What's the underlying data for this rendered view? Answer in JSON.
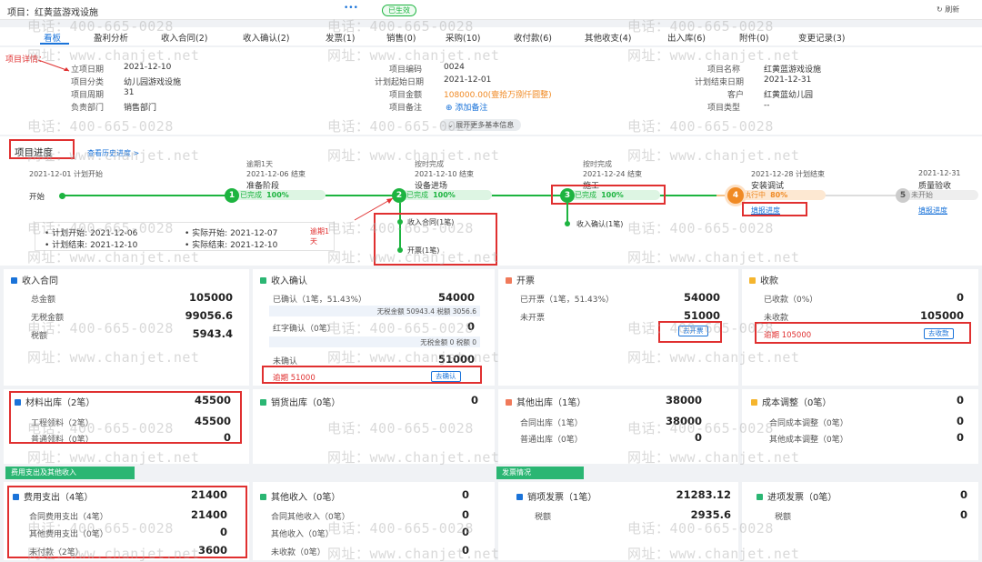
{
  "header": {
    "title": "项目：红黄蓝游戏设施",
    "more": "•••",
    "status": "已生效",
    "refresh": "刷新"
  },
  "tabs": [
    "看板",
    "盈利分析",
    "收入合同(2)",
    "收入确认(2)",
    "发票(1)",
    "销售(0)",
    "采购(10)",
    "收付款(6)",
    "其他收支(4)",
    "出入库(6)",
    "附件(0)",
    "变更记录(3)"
  ],
  "details": {
    "annotation": "项目详情：",
    "rows": [
      [
        {
          "label": "立项日期",
          "value": "2021-12-10"
        },
        {
          "label": "项目编码",
          "value": "0024"
        },
        {
          "label": "项目名称",
          "value": "红黄蓝游戏设施"
        }
      ],
      [
        {
          "label": "项目分类",
          "value": "幼儿园游戏设施"
        },
        {
          "label": "计划起始日期",
          "value": "2021-12-01"
        },
        {
          "label": "计划结束日期",
          "value": "2021-12-31"
        }
      ],
      [
        {
          "label": "项目周期",
          "value": "31"
        },
        {
          "label": "项目金额",
          "value": "108000.00(壹拾万捌仟圆整)"
        },
        {
          "label": "客户",
          "value": "红黄蓝幼儿园"
        }
      ],
      [
        {
          "label": "负责部门",
          "value": "销售部门"
        },
        {
          "label": "项目备注",
          "value": "添加备注"
        },
        {
          "label": "项目类型",
          "value": "--"
        }
      ]
    ],
    "expand": "展开更多基本信息"
  },
  "progress": {
    "title": "项目进度",
    "history_link": "查看历史进度 >",
    "start_line": "2021-12-01 计划开始",
    "start_label": "开始",
    "milestones": [
      {
        "num": "1",
        "top": "逾期1天",
        "date": "2021-12-06 结束",
        "name": "准备阶段",
        "state": "已完成",
        "pct": "100%",
        "kind": "done"
      },
      {
        "num": "2",
        "top": "按时完成",
        "date": "2021-12-10 结束",
        "name": "设备进场",
        "state": "已完成",
        "pct": "100%",
        "kind": "done"
      },
      {
        "num": "3",
        "top": "按时完成",
        "date": "2021-12-24 结束",
        "name": "施工",
        "state": "已完成",
        "pct": "100%",
        "kind": "done"
      },
      {
        "num": "4",
        "top": "",
        "date": "2021-12-28 计划结束",
        "name": "安装调试",
        "state": "执行中",
        "pct": "80%",
        "kind": "doing",
        "link": "填报进度"
      },
      {
        "num": "5",
        "top": "",
        "date": "2021-12-31",
        "name": "质量验收",
        "state": "未开始",
        "pct": "",
        "kind": "todo",
        "link": "填报进度"
      }
    ],
    "branch2": [
      "收入合同(1笔)",
      "开票(1笔)"
    ],
    "branch3": [
      "收入确认(1笔)"
    ],
    "plan_start": "• 计划开始: 2021-12-06",
    "plan_end": "• 计划结束: 2021-12-10",
    "act_start": "• 实际开始: 2021-12-07",
    "act_end": "• 实际结束: 2021-12-10",
    "overdue": "逾期1天"
  },
  "cards": {
    "contract": {
      "title": "收入合同",
      "rows": [
        {
          "label": "总金额",
          "value": "105000"
        },
        {
          "label": "无税金额",
          "value": "99056.6"
        },
        {
          "label": "税额",
          "value": "5943.4"
        }
      ]
    },
    "confirm": {
      "title": "收入确认",
      "confirmed_label": "已确认（1笔，51.43%）",
      "confirmed_value": "54000",
      "sub1": "无税金额 50943.4 税额 3056.6",
      "red_label": "红字确认（0笔）",
      "red_value": "0",
      "sub2": "无税金额 0 税额 0",
      "unconfirmed_label": "未确认",
      "unconfirmed_value": "51000",
      "overdue": "逾期 51000",
      "btn": "去确认"
    },
    "invoice": {
      "title": "开票",
      "rows": [
        {
          "label": "已开票（1笔，51.43%）",
          "value": "54000"
        },
        {
          "label": "未开票",
          "value": "51000"
        }
      ],
      "btn": "去开票"
    },
    "receipt": {
      "title": "收款",
      "rows": [
        {
          "label": "已收款（0%）",
          "value": "0"
        },
        {
          "label": "未收款",
          "value": "105000"
        }
      ],
      "overdue": "逾期 105000",
      "btn": "去收款"
    },
    "material": {
      "title": "材料出库（2笔）",
      "value": "45500",
      "rows": [
        {
          "label": "工程领料（2笔）",
          "value": "45500"
        },
        {
          "label": "普通领料（0笔）",
          "value": "0"
        }
      ]
    },
    "sales_out": {
      "title": "销货出库（0笔）",
      "value": "0"
    },
    "other_out": {
      "title": "其他出库（1笔）",
      "value": "38000",
      "rows": [
        {
          "label": "合同出库（1笔）",
          "value": "38000"
        },
        {
          "label": "普通出库（0笔）",
          "value": "0"
        }
      ]
    },
    "cost_adj": {
      "title": "成本调整（0笔）",
      "value": "0",
      "rows": [
        {
          "label": "合同成本调整（0笔）",
          "value": "0"
        },
        {
          "label": "其他成本调整（0笔）",
          "value": "0"
        }
      ]
    },
    "banner_left": "费用支出及其他收入",
    "banner_right": "发票情况",
    "expense": {
      "title": "费用支出（4笔）",
      "value": "21400",
      "rows": [
        {
          "label": "合同费用支出（4笔）",
          "value": "21400"
        },
        {
          "label": "其他费用支出（0笔）",
          "value": "0"
        },
        {
          "label": "未付款（2笔）",
          "value": "3600"
        }
      ]
    },
    "other_income": {
      "title": "其他收入（0笔）",
      "value": "0",
      "rows": [
        {
          "label": "合同其他收入（0笔）",
          "value": "0"
        },
        {
          "label": "其他收入（0笔）",
          "value": "0"
        },
        {
          "label": "未收款（0笔）",
          "value": "0"
        }
      ]
    },
    "sales_invoice": {
      "title": "销项发票（1笔）",
      "value": "21283.12",
      "rows": [
        {
          "label": "税额",
          "value": "2935.6"
        }
      ]
    },
    "input_invoice": {
      "title": "进项发票（0笔）",
      "value": "0",
      "rows": [
        {
          "label": "税额",
          "value": "0"
        }
      ]
    }
  },
  "watermark": {
    "phone": "电话：400-665-0028",
    "site": "网址：www.chanjet.net"
  },
  "colors": {
    "blue": "#1a73d9",
    "green": "#1db440",
    "orange": "#f08a24",
    "red": "#e03030"
  }
}
